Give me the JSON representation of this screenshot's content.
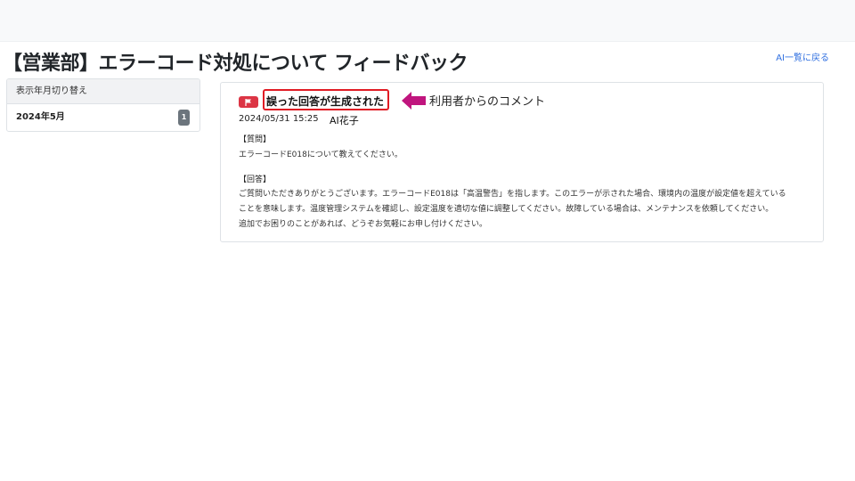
{
  "header": {
    "title": "【営業部】エラーコード対処について フィードバック",
    "back_link": "AI一覧に戻る"
  },
  "sidebar": {
    "header": "表示年月切り替え",
    "items": [
      {
        "label": "2024年5月",
        "count": "1"
      }
    ]
  },
  "feedback": {
    "tag_icon": "flag-icon",
    "tag_label": "誤った回答が生成された",
    "datetime": "2024/05/31 15:25",
    "author": "AI花子",
    "question_label": "【質問】",
    "question_text": "エラーコードE018について教えてください。",
    "answer_label": "【回答】",
    "answer_lines": [
      "ご質問いただきありがとうございます。エラーコードE018は「高温警告」を指します。このエラーが示された場合、環境内の温度が設定値を超えている",
      "ことを意味します。温度管理システムを確認し、設定温度を適切な値に調整してください。故障している場合は、メンテナンスを依頼してください。",
      "追加でお困りのことがあれば、どうぞお気軽にお申し付けください。"
    ]
  },
  "annotation": {
    "text": "利用者からのコメント",
    "arrow_color": "#c0157e",
    "highlight_color": "#e01b24"
  },
  "colors": {
    "badge_red": "#dc3545",
    "badge_gray": "#6c757d",
    "link_blue": "#2f6fe0"
  }
}
